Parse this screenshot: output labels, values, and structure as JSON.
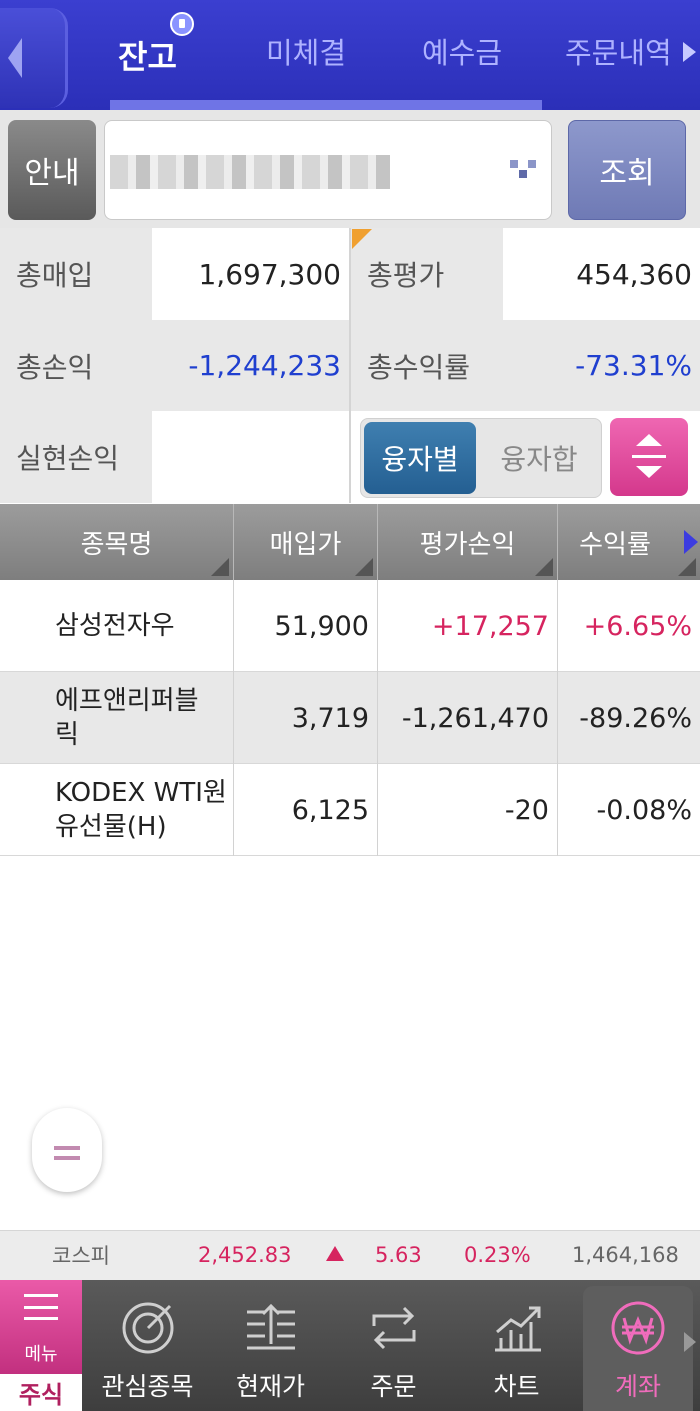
{
  "tabs": [
    "잔고",
    "미체결",
    "예수금",
    "주문내역"
  ],
  "account": {
    "guide_label": "안내",
    "search_label": "조회"
  },
  "summary": {
    "total_purchase_label": "총매입",
    "total_purchase": "1,697,300",
    "total_eval_label": "총평가",
    "total_eval": "454,360",
    "total_pl_label": "총손익",
    "total_pl": "-1,244,233",
    "total_return_label": "총수익률",
    "total_return": "-73.31%",
    "realized_label": "실현손익",
    "realized": "",
    "toggle_left": "융자별",
    "toggle_right": "융자합"
  },
  "table": {
    "headers": [
      "종목명",
      "매입가",
      "평가손익",
      "수익률"
    ],
    "rows": [
      {
        "name": "삼성전자우",
        "price": "51,900",
        "pl": "+17,257",
        "rate": "+6.65%"
      },
      {
        "name": "에프앤리퍼블릭",
        "price": "3,719",
        "pl": "-1,261,470",
        "rate": "-89.26%"
      },
      {
        "name": "KODEX WTI원유선물(H)",
        "price": "6,125",
        "pl": "-20",
        "rate": "-0.08%"
      }
    ]
  },
  "ticker": {
    "name": "코스피",
    "value": "2,452.83",
    "change": "5.63",
    "rate": "0.23%",
    "volume": "1,464,168"
  },
  "nav": {
    "menu": "메뉴",
    "stock": "주식",
    "items": [
      "관심종목",
      "현재가",
      "주문",
      "차트",
      "계좌"
    ]
  },
  "colors": {
    "accent": "#2b2fb8",
    "up": "#d6245f",
    "down": "#1f3fcf",
    "pink": "#e0489c"
  }
}
